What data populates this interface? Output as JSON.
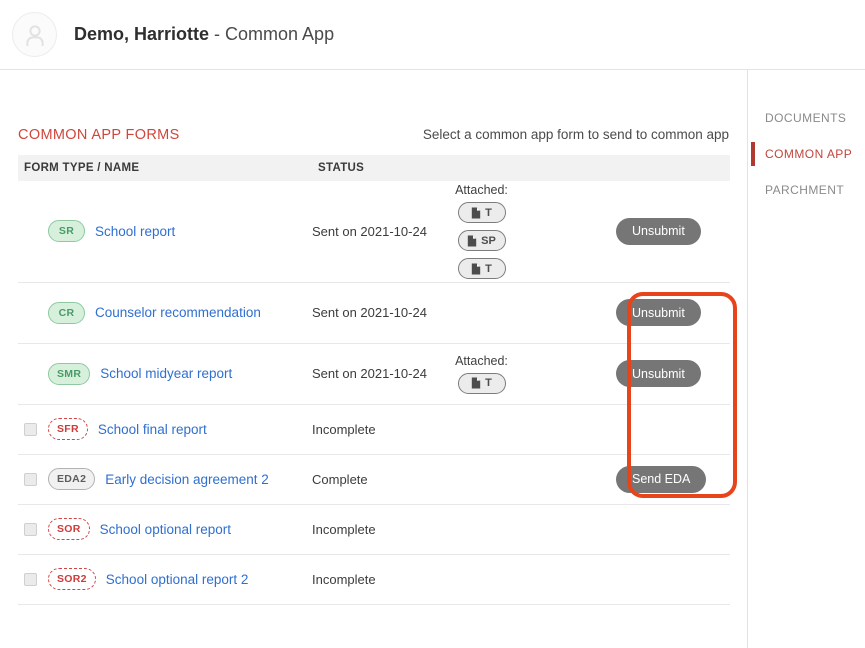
{
  "header": {
    "avatar_icon": "user-avatar-icon",
    "student_name": "Demo, Harriotte",
    "context_label": " - Common App"
  },
  "main": {
    "section_title": "COMMON APP FORMS",
    "section_hint": "Select a common app form to send to common app",
    "table": {
      "columns": [
        "FORM TYPE / NAME",
        "STATUS",
        "",
        ""
      ],
      "rows": [
        {
          "checkbox": false,
          "badge": "SR",
          "badge_style": "green",
          "name": "School report",
          "status": "Sent on 2021-10-24",
          "attached_label": "Attached:",
          "attachments": [
            "T",
            "SP",
            "T"
          ],
          "action": "Unsubmit"
        },
        {
          "checkbox": false,
          "badge": "CR",
          "badge_style": "green",
          "name": "Counselor recommendation",
          "status": "Sent on 2021-10-24",
          "attached_label": "",
          "attachments": [],
          "action": "Unsubmit"
        },
        {
          "checkbox": false,
          "badge": "SMR",
          "badge_style": "green",
          "name": "School midyear report",
          "status": "Sent on 2021-10-24",
          "attached_label": "Attached:",
          "attachments": [
            "T"
          ],
          "action": "Unsubmit"
        },
        {
          "checkbox": true,
          "badge": "SFR",
          "badge_style": "dashed-red",
          "name": "School final report",
          "status": "Incomplete",
          "attached_label": "",
          "attachments": [],
          "action": ""
        },
        {
          "checkbox": true,
          "badge": "EDA2",
          "badge_style": "solid-gray",
          "name": "Early decision agreement 2",
          "status": "Complete",
          "attached_label": "",
          "attachments": [],
          "action": "Send EDA"
        },
        {
          "checkbox": true,
          "badge": "SOR",
          "badge_style": "dashed-red",
          "name": "School optional report",
          "status": "Incomplete",
          "attached_label": "",
          "attachments": [],
          "action": ""
        },
        {
          "checkbox": true,
          "badge": "SOR2",
          "badge_style": "dashed-red",
          "name": "School optional report 2",
          "status": "Incomplete",
          "attached_label": "",
          "attachments": [],
          "action": ""
        }
      ]
    }
  },
  "sidebar": {
    "items": [
      {
        "label": "DOCUMENTS",
        "active": false
      },
      {
        "label": "COMMON APP",
        "active": true
      },
      {
        "label": "PARCHMENT",
        "active": false
      }
    ]
  },
  "annotation": {
    "shape": "rounded-rectangle-highlight",
    "color": "#e8441c"
  },
  "colors": {
    "accent_red": "#d0463b",
    "link_blue": "#2f6fd0",
    "badge_green_text": "#4a9a68",
    "badge_green_bg": "#d6f0dc",
    "badge_red": "#cc3b3b",
    "button_gray": "#767676",
    "annotation": "#e8441c"
  }
}
